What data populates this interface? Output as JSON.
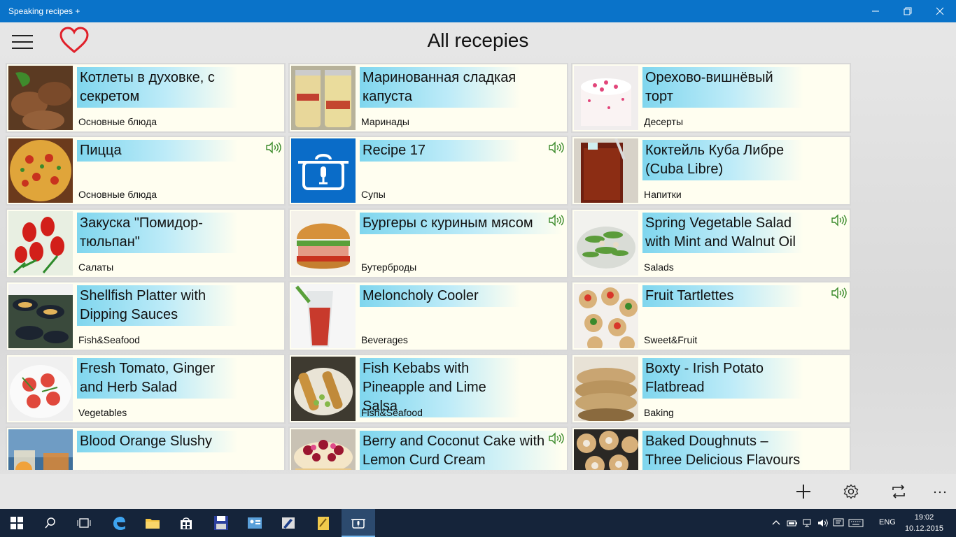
{
  "window": {
    "title": "Speaking recipes +"
  },
  "header": {
    "title": "All recepies"
  },
  "recipes": [
    {
      "title": "Котлеты в духовке, с секретом",
      "category": "Основные блюда",
      "sound": false
    },
    {
      "title": "Маринованная сладкая капуста",
      "category": "Маринады",
      "sound": false
    },
    {
      "title": "Орехово-вишнёвый торт",
      "category": "Десерты",
      "sound": false
    },
    {
      "title": "Пицца",
      "category": "Основные блюда",
      "sound": true
    },
    {
      "title": "Recipe 17",
      "category": "Супы",
      "sound": true
    },
    {
      "title": "Коктейль Куба Либре (Cuba Libre)",
      "category": "Напитки",
      "sound": false
    },
    {
      "title": "Закуска \"Помидор-тюльпан\"",
      "category": "Салаты",
      "sound": false
    },
    {
      "title": "Бургеры с куриным мясом",
      "category": "Бутерброды",
      "sound": true
    },
    {
      "title": "Spring Vegetable Salad with Mint and Walnut Oil",
      "category": "Salads",
      "sound": true
    },
    {
      "title": "Shellfish Platter with Dipping Sauces",
      "category": "Fish&Seafood",
      "sound": false
    },
    {
      "title": "Meloncholy Cooler",
      "category": "Beverages",
      "sound": false
    },
    {
      "title": "Fruit Tartlettes",
      "category": "Sweet&Fruit",
      "sound": true
    },
    {
      "title": "Fresh Tomato, Ginger and Herb Salad",
      "category": "Vegetables",
      "sound": false
    },
    {
      "title": "Fish Kebabs with Pineapple and Lime Salsa",
      "category": "Fish&Seafood",
      "sound": false
    },
    {
      "title": "Boxty - Irish Potato Flatbread",
      "category": "Baking",
      "sound": false
    },
    {
      "title": "Blood Orange Slushy",
      "category": "",
      "sound": false
    },
    {
      "title": "Berry and Coconut Cake with Lemon Curd Cream",
      "category": "",
      "sound": true
    },
    {
      "title": "Baked Doughnuts – Three Delicious Flavours",
      "category": "",
      "sound": false
    }
  ],
  "taskbar": {
    "language": "ENG",
    "time": "19:02",
    "date": "10.12.2015"
  },
  "colors": {
    "titlebar": "#0a73c9",
    "accent_gradient": "#7fd6ee",
    "tile_bg": "#fffef0",
    "taskbar": "#15243a",
    "sound_icon": "#3a8a2a"
  }
}
